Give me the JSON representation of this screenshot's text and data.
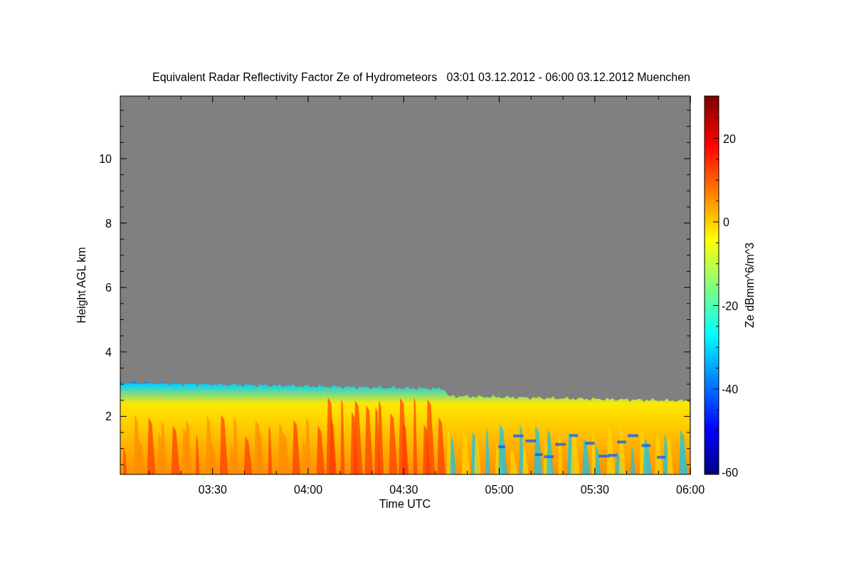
{
  "title": "Equivalent Radar Reflectivity Factor Ze of Hydrometeors   03:01 03.12.2012 - 06:00 03.12.2012 Muenchen",
  "y_axis": {
    "label": "Height AGL km",
    "ticks": [
      "10",
      "8",
      "6",
      "4",
      "2"
    ]
  },
  "x_axis": {
    "label": "Time UTC",
    "ticks": [
      "03:30",
      "04:00",
      "04:30",
      "05:00",
      "05:30",
      "06:00"
    ]
  },
  "colorbar": {
    "label": "Ze dBmm^6/m^3",
    "ticks": [
      "20",
      "0",
      "-20",
      "-40",
      "-60"
    ]
  }
}
